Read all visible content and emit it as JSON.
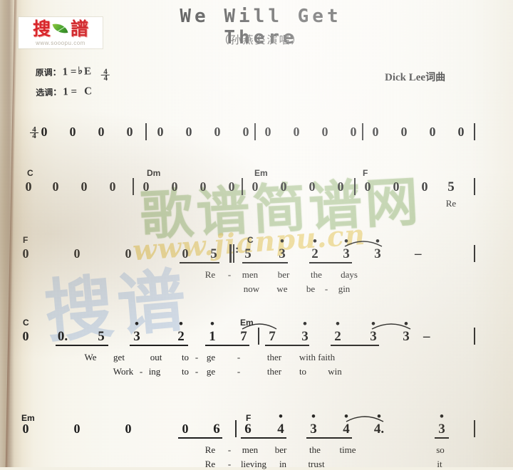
{
  "logo": {
    "char1": "搜",
    "char2": "譜",
    "url": "www.sooopu.com",
    "icon": "leaf-icon"
  },
  "watermarks": {
    "green": "歌谱简谱网",
    "yellow": "www.jianpu.cn",
    "blue": "搜谱"
  },
  "header": {
    "title": "We Will Get There",
    "subtitle": "（孙燕姿演唱）",
    "original_key_label": "原调：",
    "original_key_value": "1 =",
    "original_key_accidental": "♭",
    "original_key_note": "E",
    "time_signature_num": "4",
    "time_signature_den": "4",
    "selected_key_label": "选调：",
    "selected_key_value": "1 =",
    "selected_key_note": "C",
    "composer": "Dick Lee",
    "composer_suffix": "词曲"
  },
  "score": {
    "time_signature": {
      "num": "4",
      "den": "4"
    },
    "repeat_sign": ":",
    "dash": "–",
    "octave_dot": "•",
    "systems": [
      {
        "id": "system-1",
        "chords": [],
        "notes": [
          "0",
          "0",
          "0",
          "0",
          "0",
          "0",
          "0",
          "0",
          "0",
          "0",
          "0",
          "0",
          "0",
          "0",
          "0",
          "0"
        ],
        "lyrics_line1": [],
        "lyrics_line2": []
      },
      {
        "id": "system-2",
        "chords": [
          "C",
          "Dm",
          "Em",
          "F"
        ],
        "notes": [
          "0",
          "0",
          "0",
          "0",
          "0",
          "0",
          "0",
          "0",
          "0",
          "0",
          "0",
          "0",
          "0",
          "0",
          "0",
          "5"
        ],
        "lyrics_line1": [
          "Re"
        ],
        "lyrics_line2": []
      },
      {
        "id": "system-3",
        "chords": [
          "F",
          "C"
        ],
        "notes": [
          "0",
          "0",
          "0",
          "0",
          "5",
          "5",
          "3",
          "2",
          "3",
          "3",
          "–"
        ],
        "lyrics_line1": [
          "Re",
          "-",
          "men",
          "ber",
          "the",
          "days"
        ],
        "lyrics_line2": [
          "now",
          "we",
          "be",
          "-",
          "gin"
        ]
      },
      {
        "id": "system-4",
        "chords": [
          "C",
          "Em"
        ],
        "notes": [
          "0",
          "0.",
          "5",
          "3",
          "2",
          "1",
          "7",
          "7",
          "3",
          "2",
          "3",
          "3",
          "–"
        ],
        "lyrics_line1": [
          "We",
          "get",
          "out",
          "to",
          "-",
          "ge",
          "-",
          "ther",
          "with",
          "faith"
        ],
        "lyrics_line2": [
          "Work",
          "-",
          "ing",
          "to",
          "-",
          "ge",
          "-",
          "ther",
          "to",
          "win"
        ]
      },
      {
        "id": "system-5",
        "chords": [
          "Em",
          "F"
        ],
        "notes": [
          "0",
          "0",
          "0",
          "0",
          "6",
          "6",
          "4",
          "3",
          "4",
          "4.",
          "3"
        ],
        "lyrics_line1": [
          "Re",
          "-",
          "men",
          "ber",
          "the",
          "time",
          "so"
        ],
        "lyrics_line2": [
          "Re",
          "-",
          "lieving",
          "in",
          "trust",
          "it"
        ]
      }
    ]
  },
  "system1": {
    "n1": "0",
    "n2": "0",
    "n3": "0",
    "n4": "0",
    "n5": "0",
    "n6": "0",
    "n7": "0",
    "n8": "0",
    "n9": "0",
    "n10": "0",
    "n11": "0",
    "n12": "0",
    "n13": "0",
    "n14": "0",
    "n15": "0",
    "n16": "0"
  },
  "system2": {
    "chord1": "C",
    "chord2": "Dm",
    "chord3": "Em",
    "chord4": "F",
    "n1": "0",
    "n2": "0",
    "n3": "0",
    "n4": "0",
    "n5": "0",
    "n6": "0",
    "n7": "0",
    "n8": "0",
    "n9": "0",
    "n10": "0",
    "n11": "0",
    "n12": "0",
    "n13": "0",
    "n14": "0",
    "n15": "0",
    "n16": "5",
    "ly1": "Re"
  },
  "system3": {
    "chord1": "F",
    "chord2": "C",
    "n1": "0",
    "n2": "0",
    "n3": "0",
    "n4": "0",
    "n5": "5",
    "n6": "5",
    "n7": "3",
    "n8": "2",
    "n9": "3",
    "n10": "3",
    "n11": "–",
    "a1": "Re",
    "a2": "-",
    "a3": "men",
    "a4": "ber",
    "a5": "the",
    "a6": "days",
    "b1": "now",
    "b2": "we",
    "b3": "be",
    "b4": "-",
    "b5": "gin"
  },
  "system4": {
    "chord1": "C",
    "chord2": "Em",
    "n1": "0",
    "n2": "0.",
    "n3": "5",
    "n4": "3",
    "n5": "2",
    "n6": "1",
    "n7": "7",
    "n8": "7",
    "n9": "3",
    "n10": "2",
    "n11": "3",
    "n12": "3",
    "n13": "–",
    "a1": "We",
    "a2": "get",
    "a3": "out",
    "a4": "to",
    "a5": "-",
    "a6": "ge",
    "a7": "-",
    "a8": "ther",
    "a9": "with faith",
    "b1": "Work",
    "b2": "-",
    "b3": "ing",
    "b4": "to",
    "b5": "-",
    "b6": "ge",
    "b7": "-",
    "b8": "ther",
    "b9": "to",
    "b10": "win"
  },
  "system5": {
    "chord1": "Em",
    "chord2": "F",
    "n1": "0",
    "n2": "0",
    "n3": "0",
    "n4": "0",
    "n5": "6",
    "n6": "6",
    "n7": "4",
    "n8": "3",
    "n9": "4",
    "n10": "4.",
    "n11": "3",
    "a1": "Re",
    "a2": "-",
    "a3": "men",
    "a4": "ber",
    "a5": "the",
    "a6": "time",
    "a7": "so",
    "b1": "Re",
    "b2": "-",
    "b3": "lieving",
    "b4": "in",
    "b5": "trust",
    "b6": "it"
  }
}
